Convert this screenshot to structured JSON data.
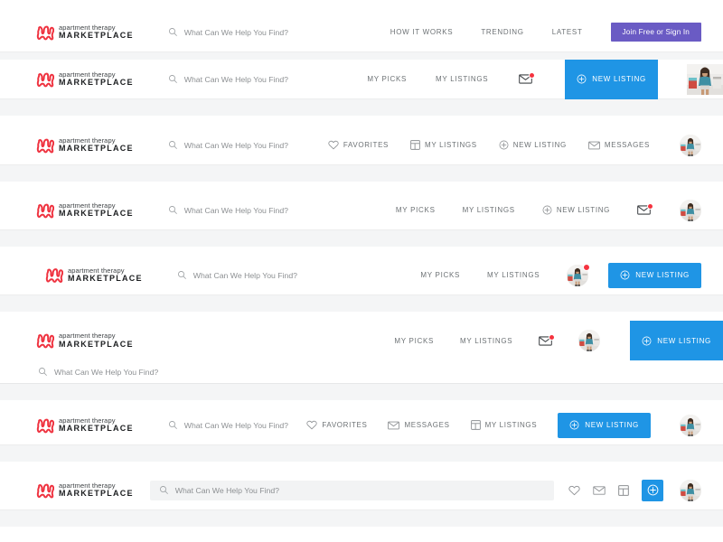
{
  "brand": {
    "line1": "apartment therapy",
    "line2": "MARKETPLACE",
    "mark_color": "#ef3340",
    "mark_icon": "squiggle-blob-logo-icon"
  },
  "search": {
    "placeholder": "What Can We Help You Find?",
    "icon": "search-icon"
  },
  "colors": {
    "purple_button": "#6a5bc4",
    "blue_button": "#1f95e5",
    "badge_red": "#f5333f",
    "band_gray": "#f4f5f6",
    "nav_text": "#6d7275"
  },
  "icons": {
    "search": "search-icon",
    "heart": "heart-icon",
    "envelope": "envelope-icon",
    "grid": "grid-listings-icon",
    "plus_circle": "plus-circle-icon",
    "avatar": "user-avatar-photo"
  },
  "variants": [
    {
      "id": "logged-out",
      "name": "header-variant-logged-out",
      "nav": [
        {
          "label": "HOW IT WORKS",
          "icon": null
        },
        {
          "label": "TRENDING",
          "icon": null
        },
        {
          "label": "LATEST",
          "icon": null
        }
      ],
      "cta": {
        "label": "Join Free or Sign In",
        "style": "purple"
      },
      "avatar": null,
      "messages_badge": false
    },
    {
      "id": "picks-listings-mail-newlisting-squareavatar",
      "name": "header-variant-2",
      "nav": [
        {
          "label": "MY PICKS",
          "icon": null
        },
        {
          "label": "MY LISTINGS",
          "icon": null
        }
      ],
      "mail": {
        "icon": "envelope-icon",
        "badge": true
      },
      "cta": {
        "label": "NEW LISTING",
        "style": "blue-tall",
        "icon": "plus-circle-icon"
      },
      "avatar": "square"
    },
    {
      "id": "four-icon-links",
      "name": "header-variant-3",
      "nav": [
        {
          "label": "FAVORITES",
          "icon": "heart-icon"
        },
        {
          "label": "MY LISTINGS",
          "icon": "grid-listings-icon"
        },
        {
          "label": "NEW LISTING",
          "icon": "plus-circle-icon"
        },
        {
          "label": "MESSAGES",
          "icon": "envelope-icon"
        }
      ],
      "avatar": "circle"
    },
    {
      "id": "picks-listings-newlisting-mail",
      "name": "header-variant-4",
      "nav": [
        {
          "label": "MY PICKS",
          "icon": null
        },
        {
          "label": "MY LISTINGS",
          "icon": null
        },
        {
          "label": "NEW LISTING",
          "icon": "plus-circle-icon"
        }
      ],
      "mail": {
        "icon": "envelope-icon",
        "badge": true
      },
      "avatar": "circle"
    },
    {
      "id": "avatar-badge-blue-cta",
      "name": "header-variant-5",
      "nav": [
        {
          "label": "MY PICKS",
          "icon": null
        },
        {
          "label": "MY LISTINGS",
          "icon": null
        }
      ],
      "avatar": "circle",
      "avatar_badge": true,
      "cta": {
        "label": "NEW LISTING",
        "style": "blue",
        "icon": "plus-circle-icon"
      }
    },
    {
      "id": "split-search-row",
      "name": "header-variant-6",
      "nav": [
        {
          "label": "MY PICKS",
          "icon": null
        },
        {
          "label": "MY LISTINGS",
          "icon": null
        }
      ],
      "mail": {
        "icon": "envelope-icon",
        "badge": true
      },
      "avatar": "circle",
      "cta": {
        "label": "NEW LISTING",
        "style": "blue-tall",
        "icon": "plus-circle-icon"
      },
      "has_search_band": true
    },
    {
      "id": "favorites-messages-listings",
      "name": "header-variant-7",
      "nav": [
        {
          "label": "FAVORITES",
          "icon": "heart-icon"
        },
        {
          "label": "MESSAGES",
          "icon": "envelope-icon"
        },
        {
          "label": "MY LISTINGS",
          "icon": "grid-listings-icon"
        }
      ],
      "cta": {
        "label": "NEW LISTING",
        "style": "blue",
        "icon": "plus-circle-icon"
      },
      "avatar": "circle"
    },
    {
      "id": "icon-only-pill-search",
      "name": "header-variant-8",
      "icon_buttons": [
        {
          "icon": "heart-icon",
          "name": "favorites-icon-button"
        },
        {
          "icon": "envelope-icon",
          "name": "messages-icon-button"
        },
        {
          "icon": "grid-listings-icon",
          "name": "my-listings-icon-button"
        },
        {
          "icon": "plus-circle-icon",
          "name": "new-listing-icon-button",
          "style": "blue"
        }
      ],
      "avatar": "circle",
      "search_style": "pill"
    }
  ]
}
